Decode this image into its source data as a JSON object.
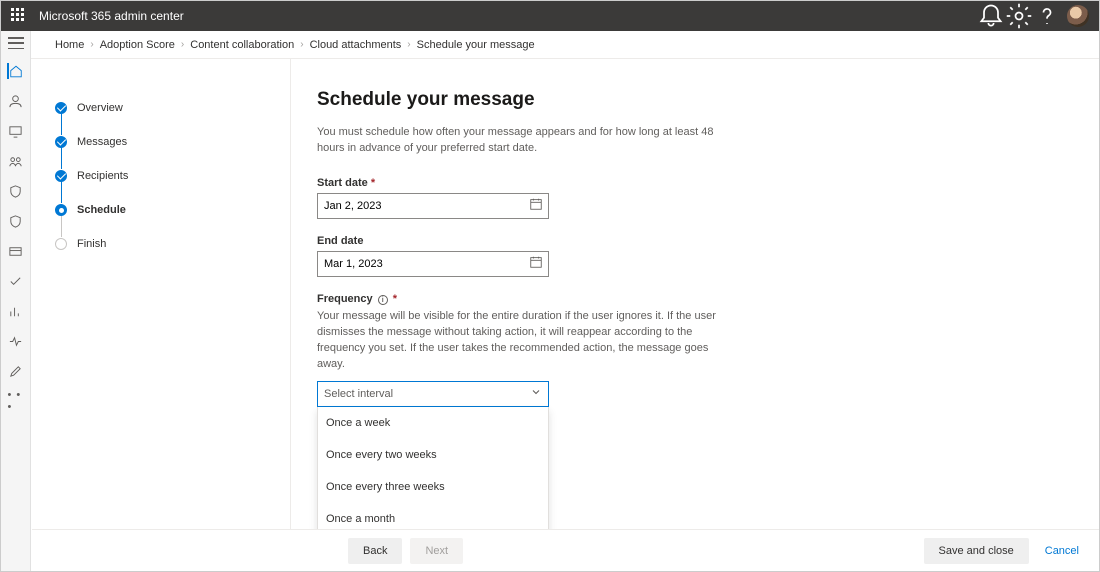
{
  "app_title": "Microsoft 365 admin center",
  "breadcrumb": [
    "Home",
    "Adoption Score",
    "Content collaboration",
    "Cloud attachments",
    "Schedule your message"
  ],
  "stepper": {
    "items": [
      {
        "label": "Overview",
        "state": "done"
      },
      {
        "label": "Messages",
        "state": "done"
      },
      {
        "label": "Recipients",
        "state": "done"
      },
      {
        "label": "Schedule",
        "state": "current"
      },
      {
        "label": "Finish",
        "state": "future"
      }
    ]
  },
  "page": {
    "title": "Schedule your message",
    "description": "You must schedule how often your message appears and for how long at least 48 hours in advance of your preferred start date.",
    "start_date_label": "Start date",
    "start_date_value": "Jan 2, 2023",
    "end_date_label": "End date",
    "end_date_value": "Mar 1, 2023",
    "frequency_label": "Frequency",
    "frequency_description": "Your message will be visible for the entire duration if the user ignores it. If the user dismisses the message without taking action, it will reappear according to the frequency you set. If the user takes the recommended action, the message goes away.",
    "frequency_placeholder": "Select interval",
    "frequency_options": [
      "Once a week",
      "Once every two weeks",
      "Once every three weeks",
      "Once a month"
    ]
  },
  "footer": {
    "back": "Back",
    "next": "Next",
    "save": "Save and close",
    "cancel": "Cancel"
  }
}
